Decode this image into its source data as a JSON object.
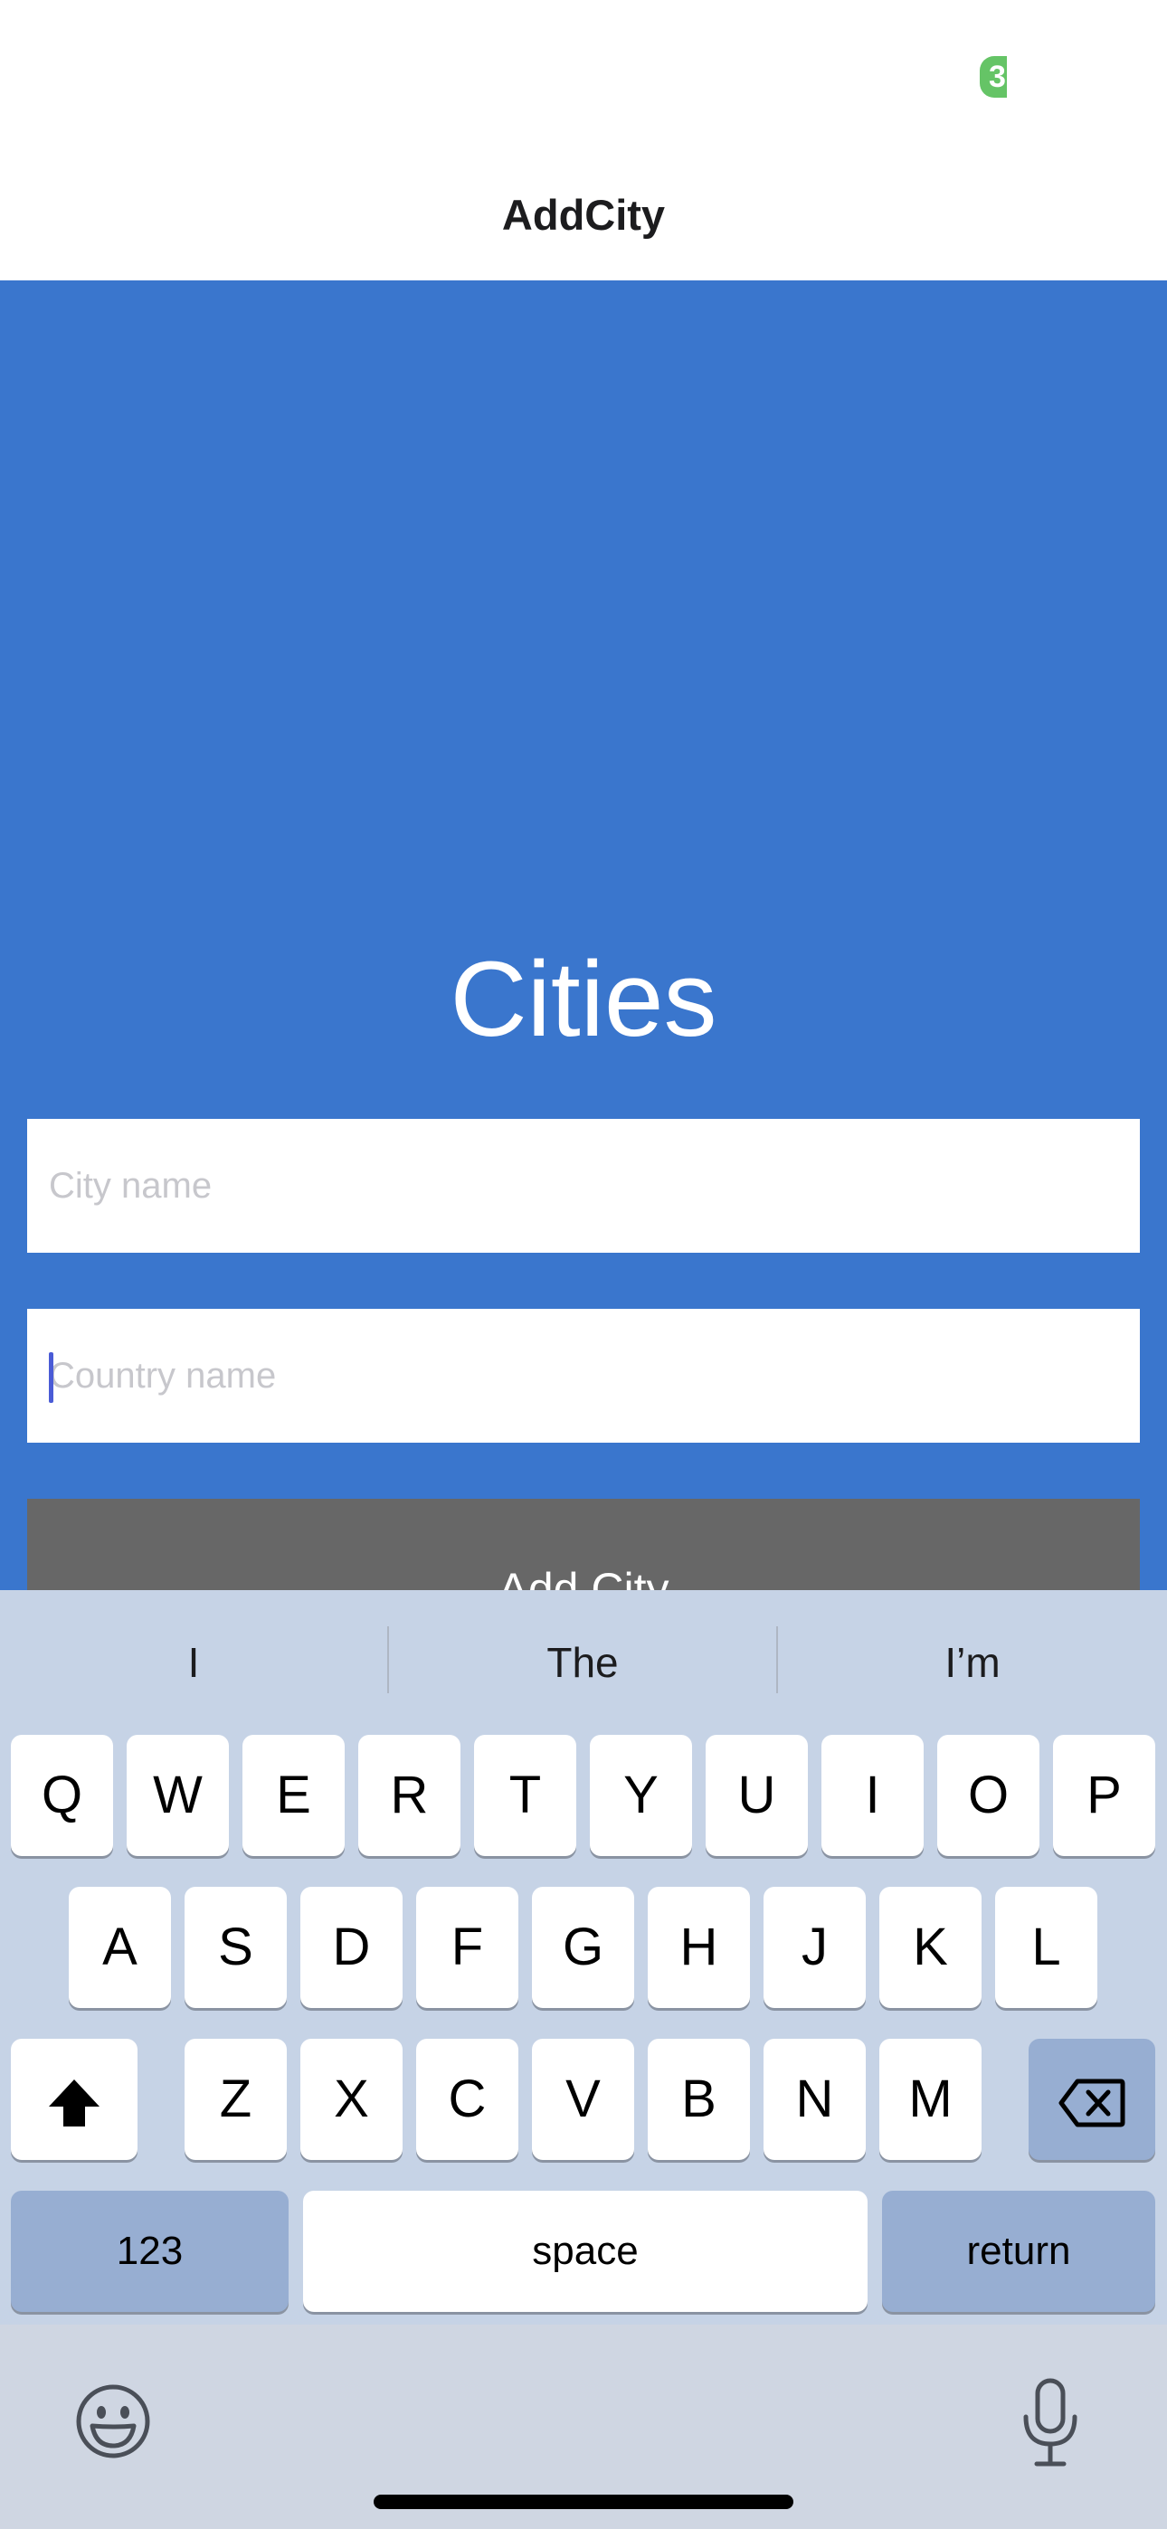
{
  "status_bar": {
    "indicator_text": "3"
  },
  "nav": {
    "title": "AddCity"
  },
  "main": {
    "heading": "Cities",
    "city_field": {
      "placeholder": "City name",
      "value": ""
    },
    "country_field": {
      "placeholder": "Country name",
      "value": ""
    },
    "add_button_label": "Add City"
  },
  "keyboard": {
    "suggestions": [
      "I",
      "The",
      "I’m"
    ],
    "row1": [
      "Q",
      "W",
      "E",
      "R",
      "T",
      "Y",
      "U",
      "I",
      "O",
      "P"
    ],
    "row2": [
      "A",
      "S",
      "D",
      "F",
      "G",
      "H",
      "J",
      "K",
      "L"
    ],
    "row3": [
      "Z",
      "X",
      "C",
      "V",
      "B",
      "N",
      "M"
    ],
    "numbers_label": "123",
    "space_label": "space",
    "return_label": "return",
    "icons": {
      "shift": "shift-icon",
      "delete": "backspace-icon",
      "emoji": "emoji-icon",
      "dictation": "microphone-icon"
    }
  },
  "colors": {
    "accent_blue": "#3a76cd",
    "button_gray": "#676767",
    "keyboard_bg": "#c6d3e6",
    "status_green": "#65c466"
  }
}
